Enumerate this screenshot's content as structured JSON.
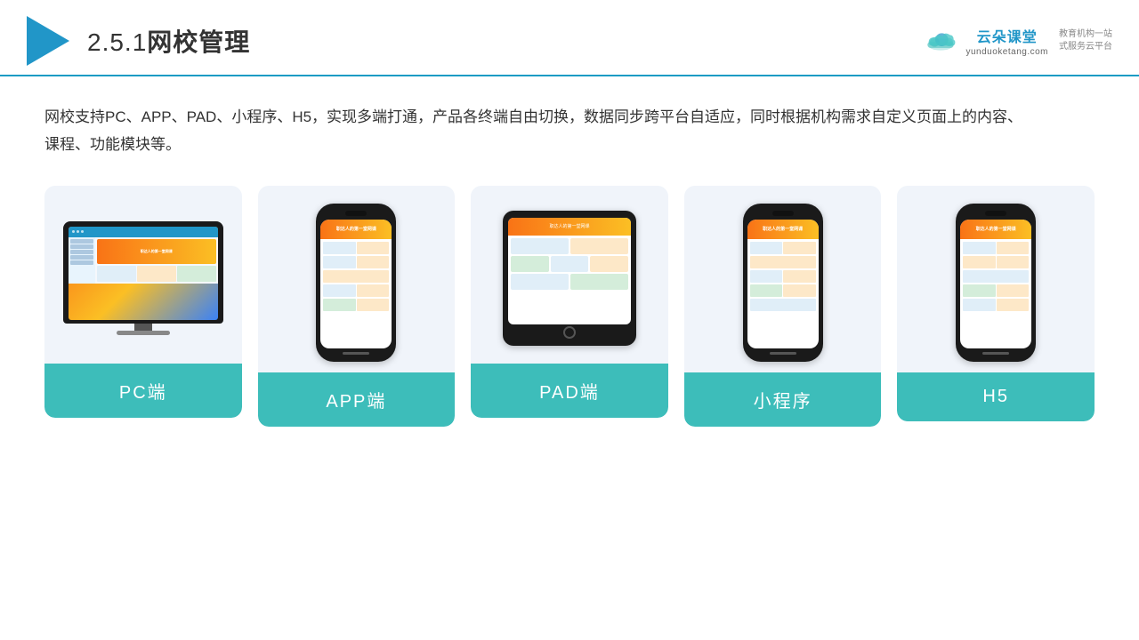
{
  "header": {
    "section_number": "2.5.1",
    "title": "网校管理",
    "logo_brand": "云朵课堂",
    "logo_url": "yunduoketang.com",
    "logo_tagline": "教育机构一站\n式服务云平台"
  },
  "description": "网校支持PC、APP、PAD、小程序、H5，实现多端打通，产品各终端自由切换，数据同步跨平台自适应，同时根据机构需求自定义页面上的内容、课程、功能模块等。",
  "cards": [
    {
      "id": "pc",
      "label": "PC端",
      "type": "pc"
    },
    {
      "id": "app",
      "label": "APP端",
      "type": "phone"
    },
    {
      "id": "pad",
      "label": "PAD端",
      "type": "pad"
    },
    {
      "id": "miniapp",
      "label": "小程序",
      "type": "phone"
    },
    {
      "id": "h5",
      "label": "H5",
      "type": "phone"
    }
  ],
  "colors": {
    "accent_blue": "#2196c8",
    "card_bg": "#f0f4fa",
    "label_bg": "#3dbdba",
    "border": "#1a9bc4"
  }
}
